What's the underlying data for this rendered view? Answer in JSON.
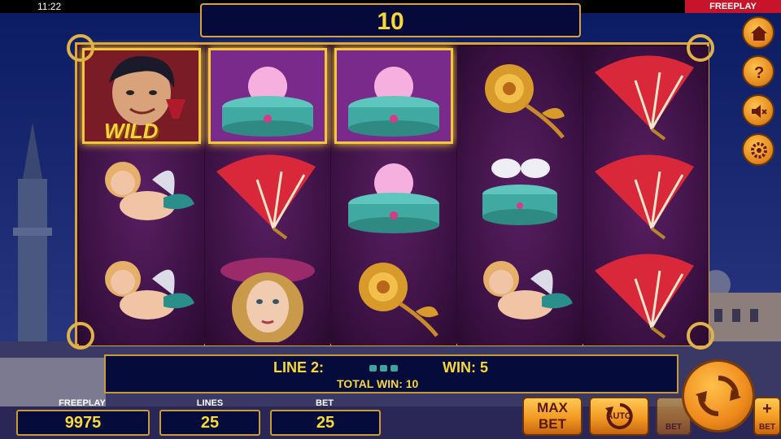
{
  "status_bar": {
    "time": "11:22",
    "mode_tag": "FREEPLAY"
  },
  "win_counter": "10",
  "reels": [
    [
      {
        "symbol": "wild-man",
        "label": "WILD",
        "highlight": true
      },
      {
        "symbol": "cupid"
      },
      {
        "symbol": "cupid"
      }
    ],
    [
      {
        "symbol": "jewel-box",
        "highlight": true
      },
      {
        "symbol": "fan"
      },
      {
        "symbol": "lady"
      }
    ],
    [
      {
        "symbol": "jewel-box",
        "highlight": true
      },
      {
        "symbol": "jewel-box"
      },
      {
        "symbol": "rose"
      }
    ],
    [
      {
        "symbol": "rose"
      },
      {
        "symbol": "doves-box"
      },
      {
        "symbol": "cupid"
      }
    ],
    [
      {
        "symbol": "fan"
      },
      {
        "symbol": "fan"
      },
      {
        "symbol": "fan"
      }
    ]
  ],
  "info_panel": {
    "line_label": "LINE 2:",
    "win_label": "WIN: 5",
    "total_label": "TOTAL WIN: 10"
  },
  "bottom": {
    "freeplay_label": "FREEPLAY",
    "freeplay_value": "9975",
    "lines_label": "LINES",
    "lines_value": "25",
    "bet_label": "BET",
    "bet_value": "25"
  },
  "buttons": {
    "max_bet_line1": "MAX",
    "max_bet_line2": "BET",
    "auto": "AUTO",
    "bet_minus": "BET",
    "bet_plus": "BET"
  },
  "icons": [
    "home-icon",
    "help-icon",
    "mute-icon",
    "settings-icon",
    "spin-icon",
    "auto-icon"
  ],
  "colors": {
    "gold": "#f6d83a",
    "panel": "#050b3a",
    "frame": "#d9a43c",
    "orange": "#f29a23"
  }
}
